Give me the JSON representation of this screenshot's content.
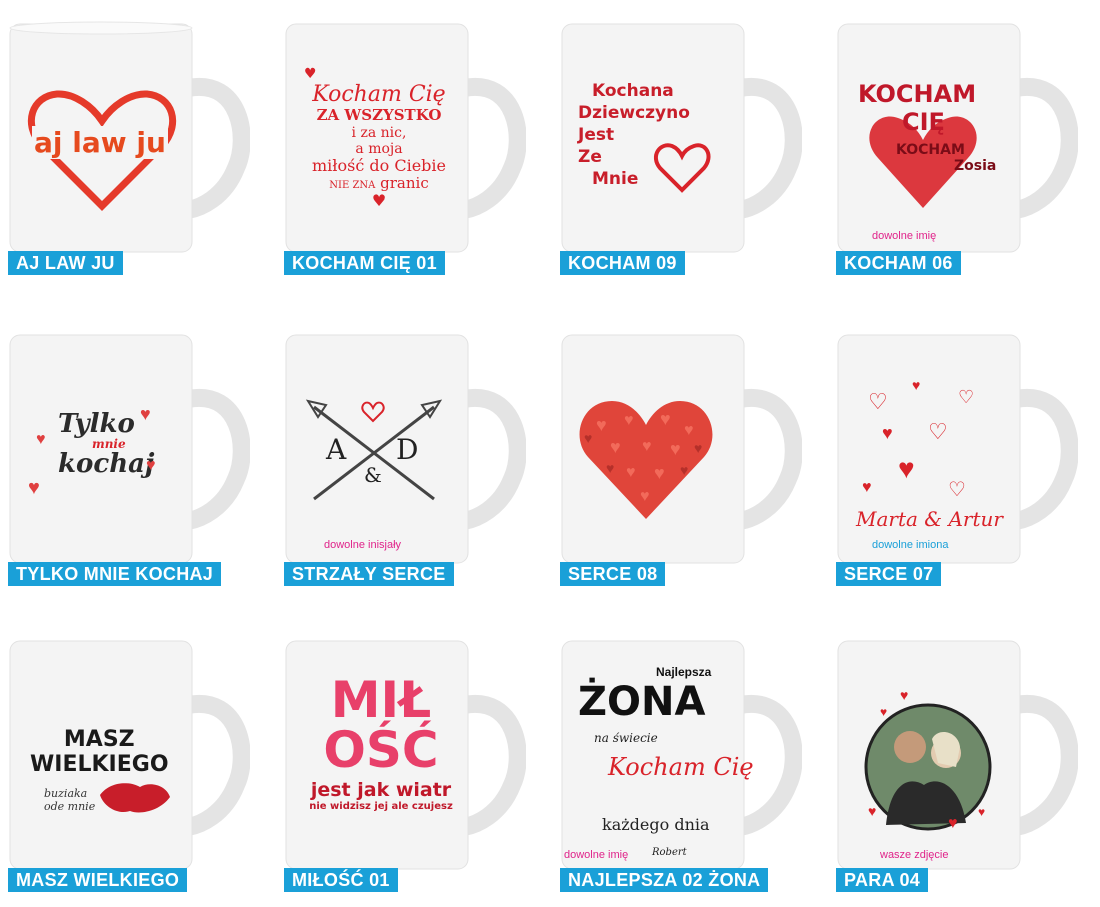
{
  "products": [
    {
      "id": "aj-law-ju",
      "label": "AJ LAW JU",
      "design": {
        "text": "aj law ju"
      }
    },
    {
      "id": "kocham-cie-01",
      "label": "KOCHAM CIĘ 01",
      "design": {
        "line1": "Kocham Cię",
        "line2": "ZA WSZYSTKO",
        "line3": "i za nic,",
        "line4": "a moja",
        "line5": "miłość do Ciebie",
        "line6a": "NIE ZNA",
        "line6b": "granic"
      }
    },
    {
      "id": "kocham-09",
      "label": "KOCHAM 09",
      "design": {
        "line1": "Kochana",
        "line2": "Dziewczyno",
        "line3": "Jest",
        "line4": "Ze",
        "line5": "Mnie"
      }
    },
    {
      "id": "kocham-06",
      "label": "KOCHAM 06",
      "design": {
        "line1": "KOCHAM",
        "line2": "CIĘ",
        "line3": "KOCHAM",
        "line4": "Zosia"
      },
      "note": "dowolne imię"
    },
    {
      "id": "tylko-mnie-kochaj",
      "label": "TYLKO MNIE KOCHAJ",
      "design": {
        "line1": "Tylko",
        "line2": "mnie",
        "line3": "kochaj"
      }
    },
    {
      "id": "strzaly-serce",
      "label": "STRZAŁY SERCE",
      "design": {
        "letter_left": "A",
        "letter_right": "D",
        "amp": "&"
      },
      "note": "dowolne inisjały"
    },
    {
      "id": "serce-08",
      "label": "SERCE 08",
      "design": {}
    },
    {
      "id": "serce-07",
      "label": "SERCE 07",
      "design": {
        "names": "Marta & Artur"
      },
      "note": "dowolne imiona"
    },
    {
      "id": "masz-wielkiego",
      "label": "MASZ WIELKIEGO",
      "design": {
        "line1": "MASZ",
        "line2": "WIELKIEGO",
        "line3": "buziaka",
        "line4": "ode mnie"
      }
    },
    {
      "id": "milosc-01",
      "label": "MIŁOŚĆ 01",
      "design": {
        "line1": "MIŁ",
        "line2": "OŚĆ",
        "line3": "jest jak wiatr",
        "line4": "nie widzisz jej ale czujesz"
      }
    },
    {
      "id": "najlepsza-02-zona",
      "label": "NAJLEPSZA 02 ŻONA",
      "design": {
        "line1": "Najlepsza",
        "line2": "ŻONA",
        "line3": "na świecie",
        "line4": "Kocham Cię",
        "line5": "każdego dnia",
        "line6": "Robert"
      },
      "note": "dowolne imię"
    },
    {
      "id": "para-04",
      "label": "PARA 04",
      "design": {},
      "note": "wasze zdjęcie"
    }
  ]
}
